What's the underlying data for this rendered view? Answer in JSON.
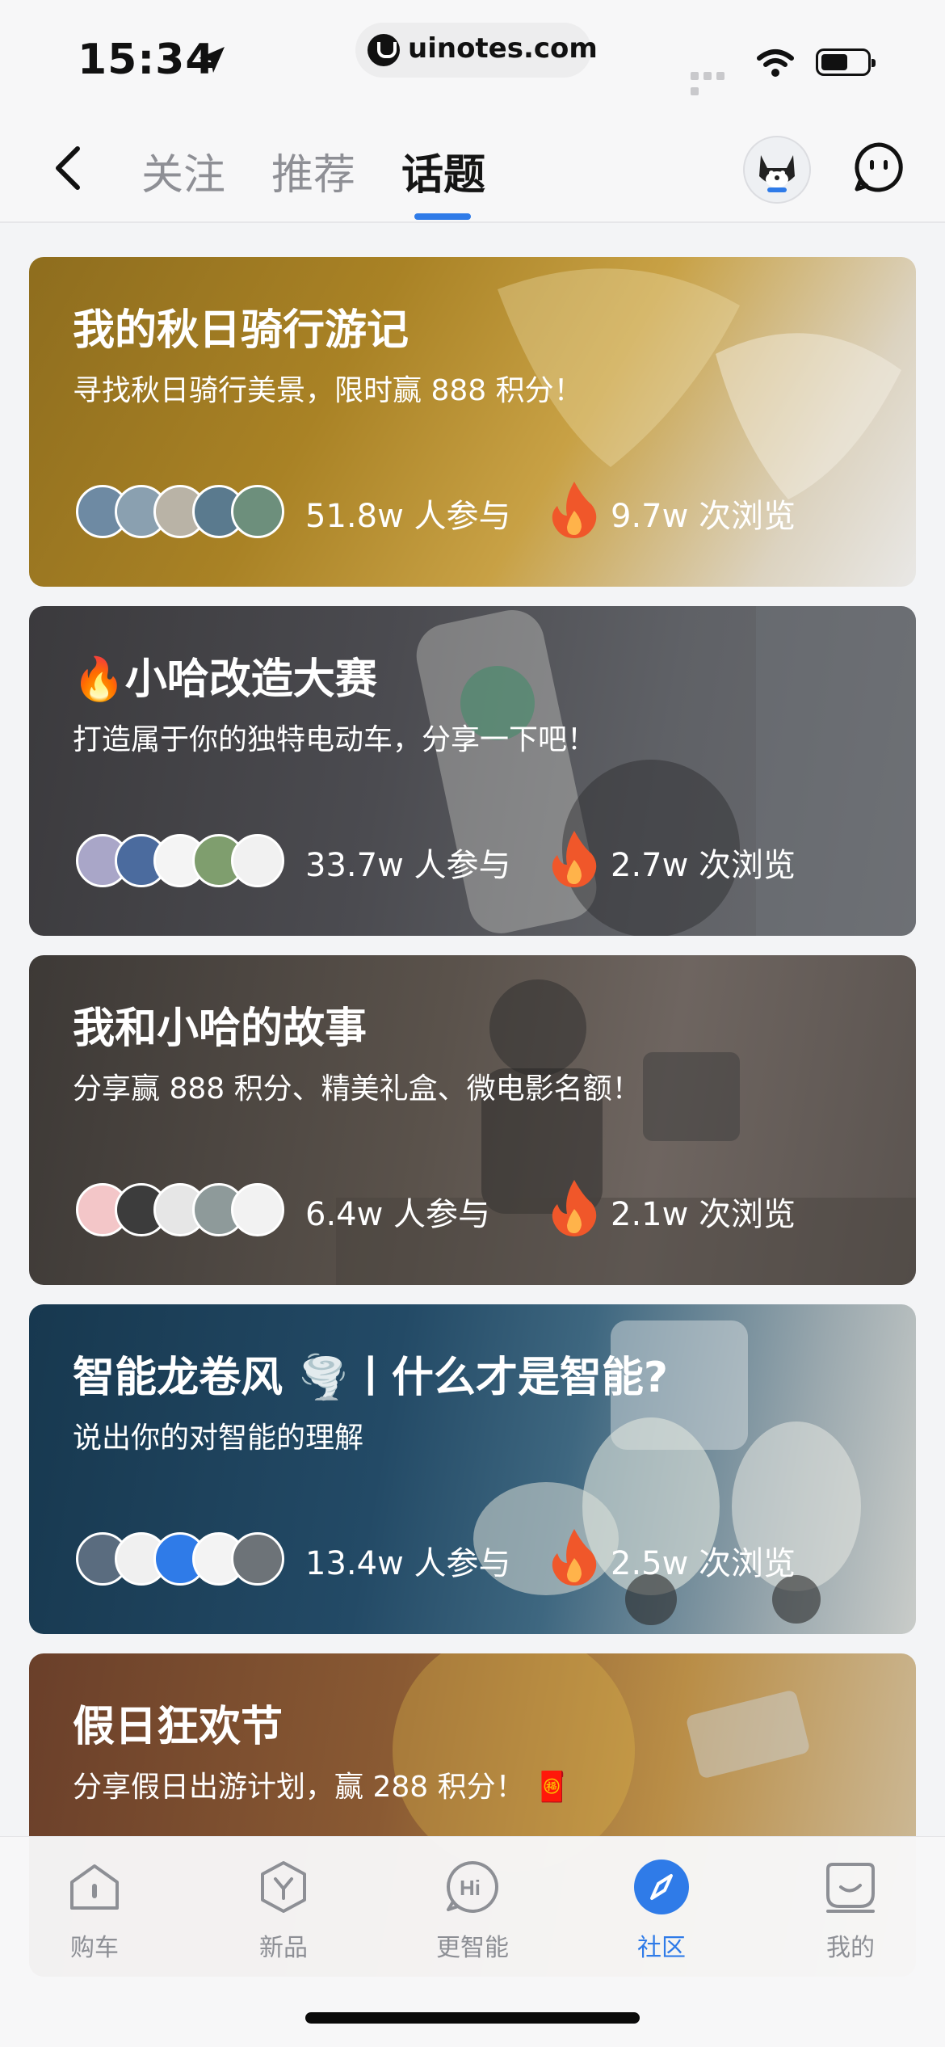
{
  "status_bar": {
    "time": "15:34",
    "url": "uinotes.com"
  },
  "nav": {
    "tabs": [
      {
        "label": "关注",
        "active": false
      },
      {
        "label": "推荐",
        "active": false
      },
      {
        "label": "话题",
        "active": true
      }
    ],
    "accent_color": "#2f7be8"
  },
  "topics": [
    {
      "title": "我的秋日骑行游记",
      "subtitle": "寻找秋日骑行美景，限时赢 888 积分！",
      "participants": "51.8w 人参与",
      "views": "9.7w 次浏览"
    },
    {
      "title": "小哈改造大赛",
      "title_emoji": "🔥",
      "subtitle": "打造属于你的独特电动车，分享一下吧！",
      "participants": "33.7w 人参与",
      "views": "2.7w 次浏览"
    },
    {
      "title": "我和小哈的故事",
      "subtitle": "分享赢 888 积分、精美礼盒、微电影名额！",
      "participants": "6.4w 人参与",
      "views": "2.1w 次浏览"
    },
    {
      "title": "智能龙卷风 🌪️丨什么才是智能?",
      "subtitle": "说出你的对智能的理解",
      "participants": "13.4w 人参与",
      "views": "2.5w 次浏览"
    },
    {
      "title": "假日狂欢节",
      "subtitle": "分享假日出游计划，赢 288 积分！",
      "subtitle_emoji": "🧧"
    }
  ],
  "tabbar": {
    "items": [
      {
        "label": "购车",
        "icon": "car-shop-icon",
        "active": false
      },
      {
        "label": "新品",
        "icon": "new-product-icon",
        "active": false
      },
      {
        "label": "更智能",
        "icon": "hi-smart-icon",
        "active": false
      },
      {
        "label": "社区",
        "icon": "compass-icon",
        "active": true
      },
      {
        "label": "我的",
        "icon": "profile-icon",
        "active": false
      }
    ]
  }
}
